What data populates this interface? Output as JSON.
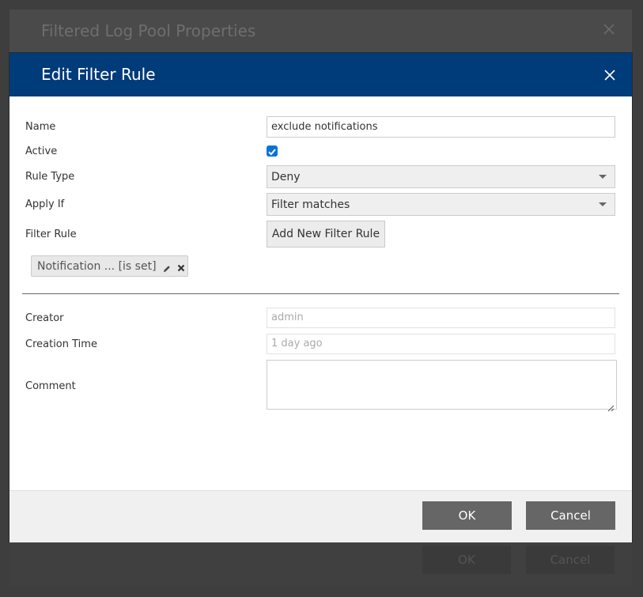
{
  "background_dialog": {
    "title": "Filtered Log Pool Properties",
    "ok_label": "OK",
    "cancel_label": "Cancel"
  },
  "dialog": {
    "title": "Edit Filter Rule",
    "close_icon": "close-icon",
    "fields": {
      "name_label": "Name",
      "name_value": "exclude notifications",
      "active_label": "Active",
      "active_checked": true,
      "rule_type_label": "Rule Type",
      "rule_type_value": "Deny",
      "apply_if_label": "Apply If",
      "apply_if_value": "Filter matches",
      "filter_rule_label": "Filter Rule",
      "add_filter_rule_label": "Add New Filter Rule",
      "filter_tag_text": "Notification ... [is set]",
      "creator_label": "Creator",
      "creator_value": "admin",
      "creation_time_label": "Creation Time",
      "creation_time_value": "1 day ago",
      "comment_label": "Comment",
      "comment_value": ""
    },
    "footer": {
      "ok_label": "OK",
      "cancel_label": "Cancel"
    }
  },
  "colors": {
    "header_bg": "#003b7a",
    "checkbox_accent": "#0a73d8",
    "button_bg": "#666666"
  }
}
